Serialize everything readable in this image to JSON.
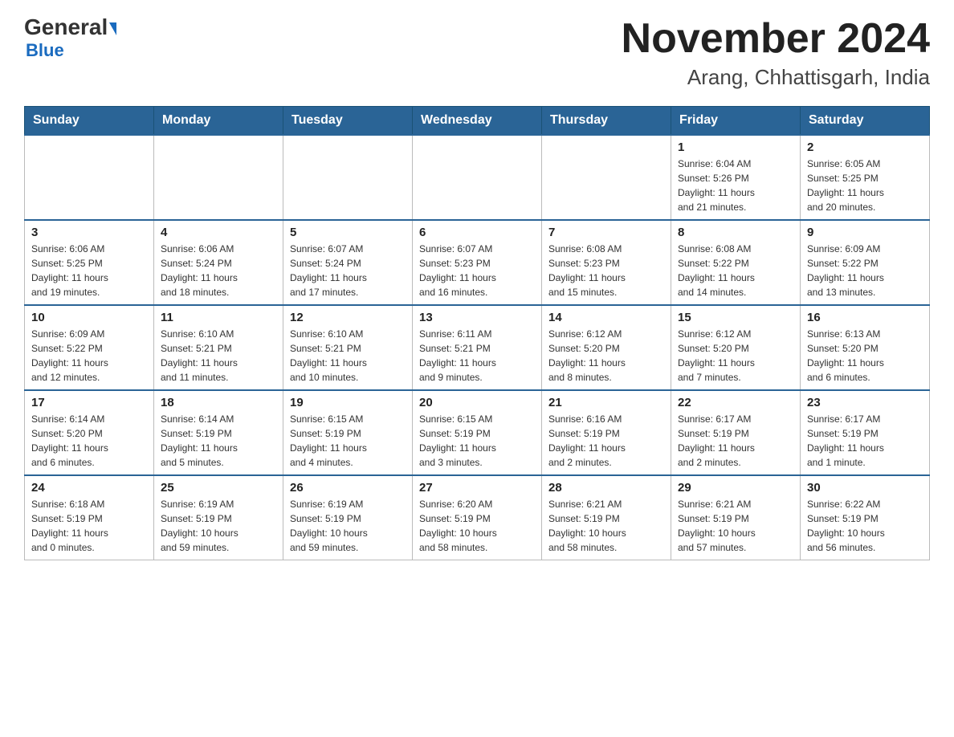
{
  "header": {
    "logo_general": "General",
    "logo_blue": "Blue",
    "main_title": "November 2024",
    "sub_title": "Arang, Chhattisgarh, India"
  },
  "weekdays": [
    "Sunday",
    "Monday",
    "Tuesday",
    "Wednesday",
    "Thursday",
    "Friday",
    "Saturday"
  ],
  "weeks": [
    [
      {
        "day": "",
        "info": ""
      },
      {
        "day": "",
        "info": ""
      },
      {
        "day": "",
        "info": ""
      },
      {
        "day": "",
        "info": ""
      },
      {
        "day": "",
        "info": ""
      },
      {
        "day": "1",
        "info": "Sunrise: 6:04 AM\nSunset: 5:26 PM\nDaylight: 11 hours\nand 21 minutes."
      },
      {
        "day": "2",
        "info": "Sunrise: 6:05 AM\nSunset: 5:25 PM\nDaylight: 11 hours\nand 20 minutes."
      }
    ],
    [
      {
        "day": "3",
        "info": "Sunrise: 6:06 AM\nSunset: 5:25 PM\nDaylight: 11 hours\nand 19 minutes."
      },
      {
        "day": "4",
        "info": "Sunrise: 6:06 AM\nSunset: 5:24 PM\nDaylight: 11 hours\nand 18 minutes."
      },
      {
        "day": "5",
        "info": "Sunrise: 6:07 AM\nSunset: 5:24 PM\nDaylight: 11 hours\nand 17 minutes."
      },
      {
        "day": "6",
        "info": "Sunrise: 6:07 AM\nSunset: 5:23 PM\nDaylight: 11 hours\nand 16 minutes."
      },
      {
        "day": "7",
        "info": "Sunrise: 6:08 AM\nSunset: 5:23 PM\nDaylight: 11 hours\nand 15 minutes."
      },
      {
        "day": "8",
        "info": "Sunrise: 6:08 AM\nSunset: 5:22 PM\nDaylight: 11 hours\nand 14 minutes."
      },
      {
        "day": "9",
        "info": "Sunrise: 6:09 AM\nSunset: 5:22 PM\nDaylight: 11 hours\nand 13 minutes."
      }
    ],
    [
      {
        "day": "10",
        "info": "Sunrise: 6:09 AM\nSunset: 5:22 PM\nDaylight: 11 hours\nand 12 minutes."
      },
      {
        "day": "11",
        "info": "Sunrise: 6:10 AM\nSunset: 5:21 PM\nDaylight: 11 hours\nand 11 minutes."
      },
      {
        "day": "12",
        "info": "Sunrise: 6:10 AM\nSunset: 5:21 PM\nDaylight: 11 hours\nand 10 minutes."
      },
      {
        "day": "13",
        "info": "Sunrise: 6:11 AM\nSunset: 5:21 PM\nDaylight: 11 hours\nand 9 minutes."
      },
      {
        "day": "14",
        "info": "Sunrise: 6:12 AM\nSunset: 5:20 PM\nDaylight: 11 hours\nand 8 minutes."
      },
      {
        "day": "15",
        "info": "Sunrise: 6:12 AM\nSunset: 5:20 PM\nDaylight: 11 hours\nand 7 minutes."
      },
      {
        "day": "16",
        "info": "Sunrise: 6:13 AM\nSunset: 5:20 PM\nDaylight: 11 hours\nand 6 minutes."
      }
    ],
    [
      {
        "day": "17",
        "info": "Sunrise: 6:14 AM\nSunset: 5:20 PM\nDaylight: 11 hours\nand 6 minutes."
      },
      {
        "day": "18",
        "info": "Sunrise: 6:14 AM\nSunset: 5:19 PM\nDaylight: 11 hours\nand 5 minutes."
      },
      {
        "day": "19",
        "info": "Sunrise: 6:15 AM\nSunset: 5:19 PM\nDaylight: 11 hours\nand 4 minutes."
      },
      {
        "day": "20",
        "info": "Sunrise: 6:15 AM\nSunset: 5:19 PM\nDaylight: 11 hours\nand 3 minutes."
      },
      {
        "day": "21",
        "info": "Sunrise: 6:16 AM\nSunset: 5:19 PM\nDaylight: 11 hours\nand 2 minutes."
      },
      {
        "day": "22",
        "info": "Sunrise: 6:17 AM\nSunset: 5:19 PM\nDaylight: 11 hours\nand 2 minutes."
      },
      {
        "day": "23",
        "info": "Sunrise: 6:17 AM\nSunset: 5:19 PM\nDaylight: 11 hours\nand 1 minute."
      }
    ],
    [
      {
        "day": "24",
        "info": "Sunrise: 6:18 AM\nSunset: 5:19 PM\nDaylight: 11 hours\nand 0 minutes."
      },
      {
        "day": "25",
        "info": "Sunrise: 6:19 AM\nSunset: 5:19 PM\nDaylight: 10 hours\nand 59 minutes."
      },
      {
        "day": "26",
        "info": "Sunrise: 6:19 AM\nSunset: 5:19 PM\nDaylight: 10 hours\nand 59 minutes."
      },
      {
        "day": "27",
        "info": "Sunrise: 6:20 AM\nSunset: 5:19 PM\nDaylight: 10 hours\nand 58 minutes."
      },
      {
        "day": "28",
        "info": "Sunrise: 6:21 AM\nSunset: 5:19 PM\nDaylight: 10 hours\nand 58 minutes."
      },
      {
        "day": "29",
        "info": "Sunrise: 6:21 AM\nSunset: 5:19 PM\nDaylight: 10 hours\nand 57 minutes."
      },
      {
        "day": "30",
        "info": "Sunrise: 6:22 AM\nSunset: 5:19 PM\nDaylight: 10 hours\nand 56 minutes."
      }
    ]
  ]
}
